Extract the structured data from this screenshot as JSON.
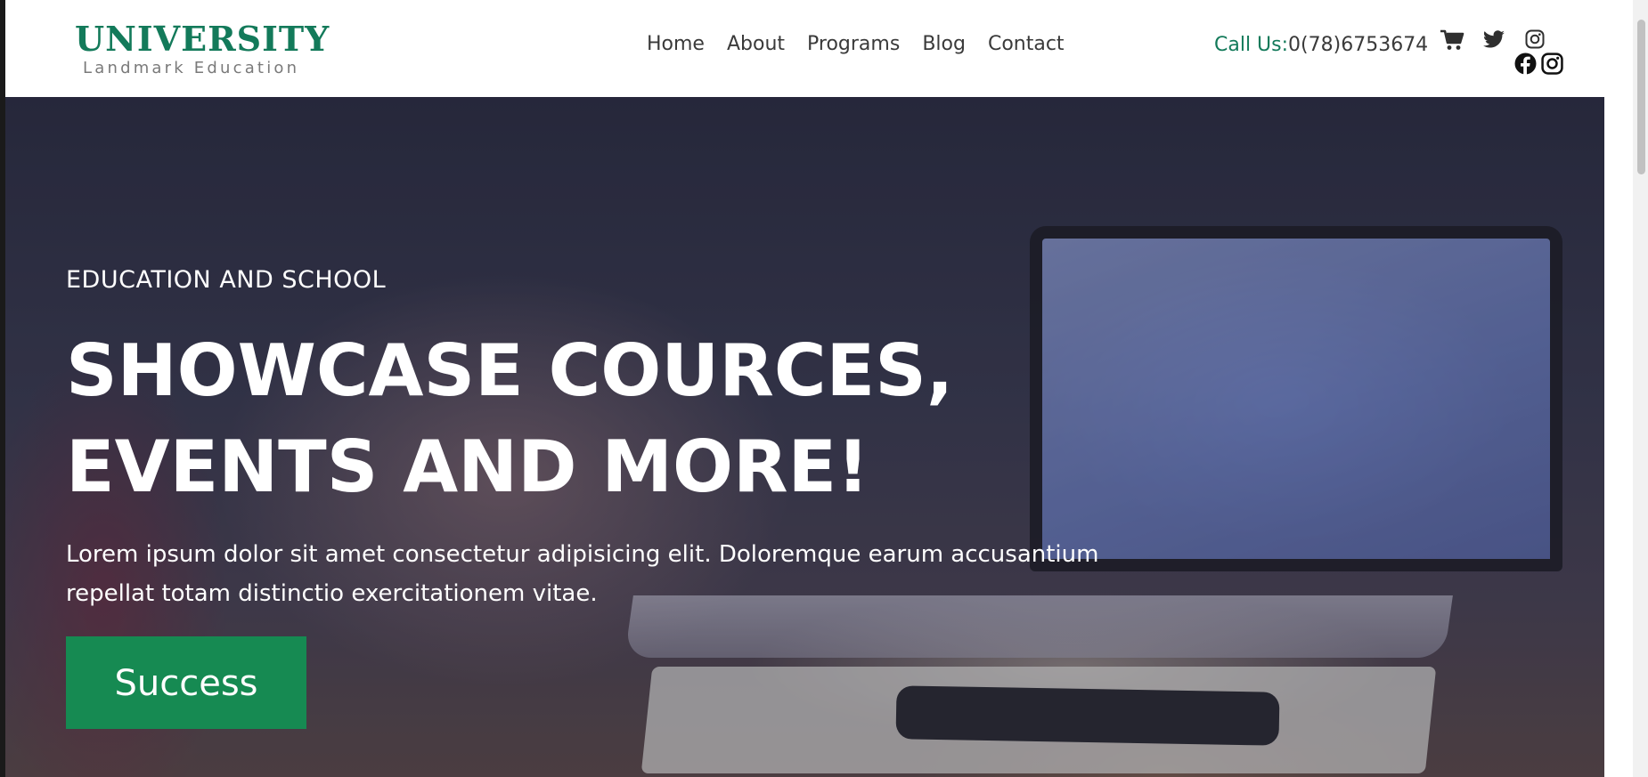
{
  "logo": {
    "title": "UNIVERSITY",
    "subtitle": "Landmark Education"
  },
  "nav": {
    "items": [
      {
        "label": "Home"
      },
      {
        "label": "About"
      },
      {
        "label": "Programs"
      },
      {
        "label": "Blog"
      },
      {
        "label": "Contact"
      }
    ]
  },
  "contact": {
    "label": "Call Us:",
    "phone": "0(78)6753674"
  },
  "icons": {
    "cart": "cart-icon",
    "twitter": "twitter-icon",
    "instagram": "instagram-icon",
    "facebook": "facebook-icon"
  },
  "hero": {
    "eyebrow": "EDUCATION AND SCHOOL",
    "headline": "SHOWCASE COURCES, EVENTS AND MORE!",
    "lead": "Lorem ipsum dolor sit amet consectetur adipisicing elit. Doloremque earum accusantium repellat totam distinctio exercitationem vitae.",
    "cta_label": "Success"
  },
  "colors": {
    "brand_green": "#137a5a",
    "button_green": "#168a52",
    "nav_text": "#3a3a3a"
  }
}
